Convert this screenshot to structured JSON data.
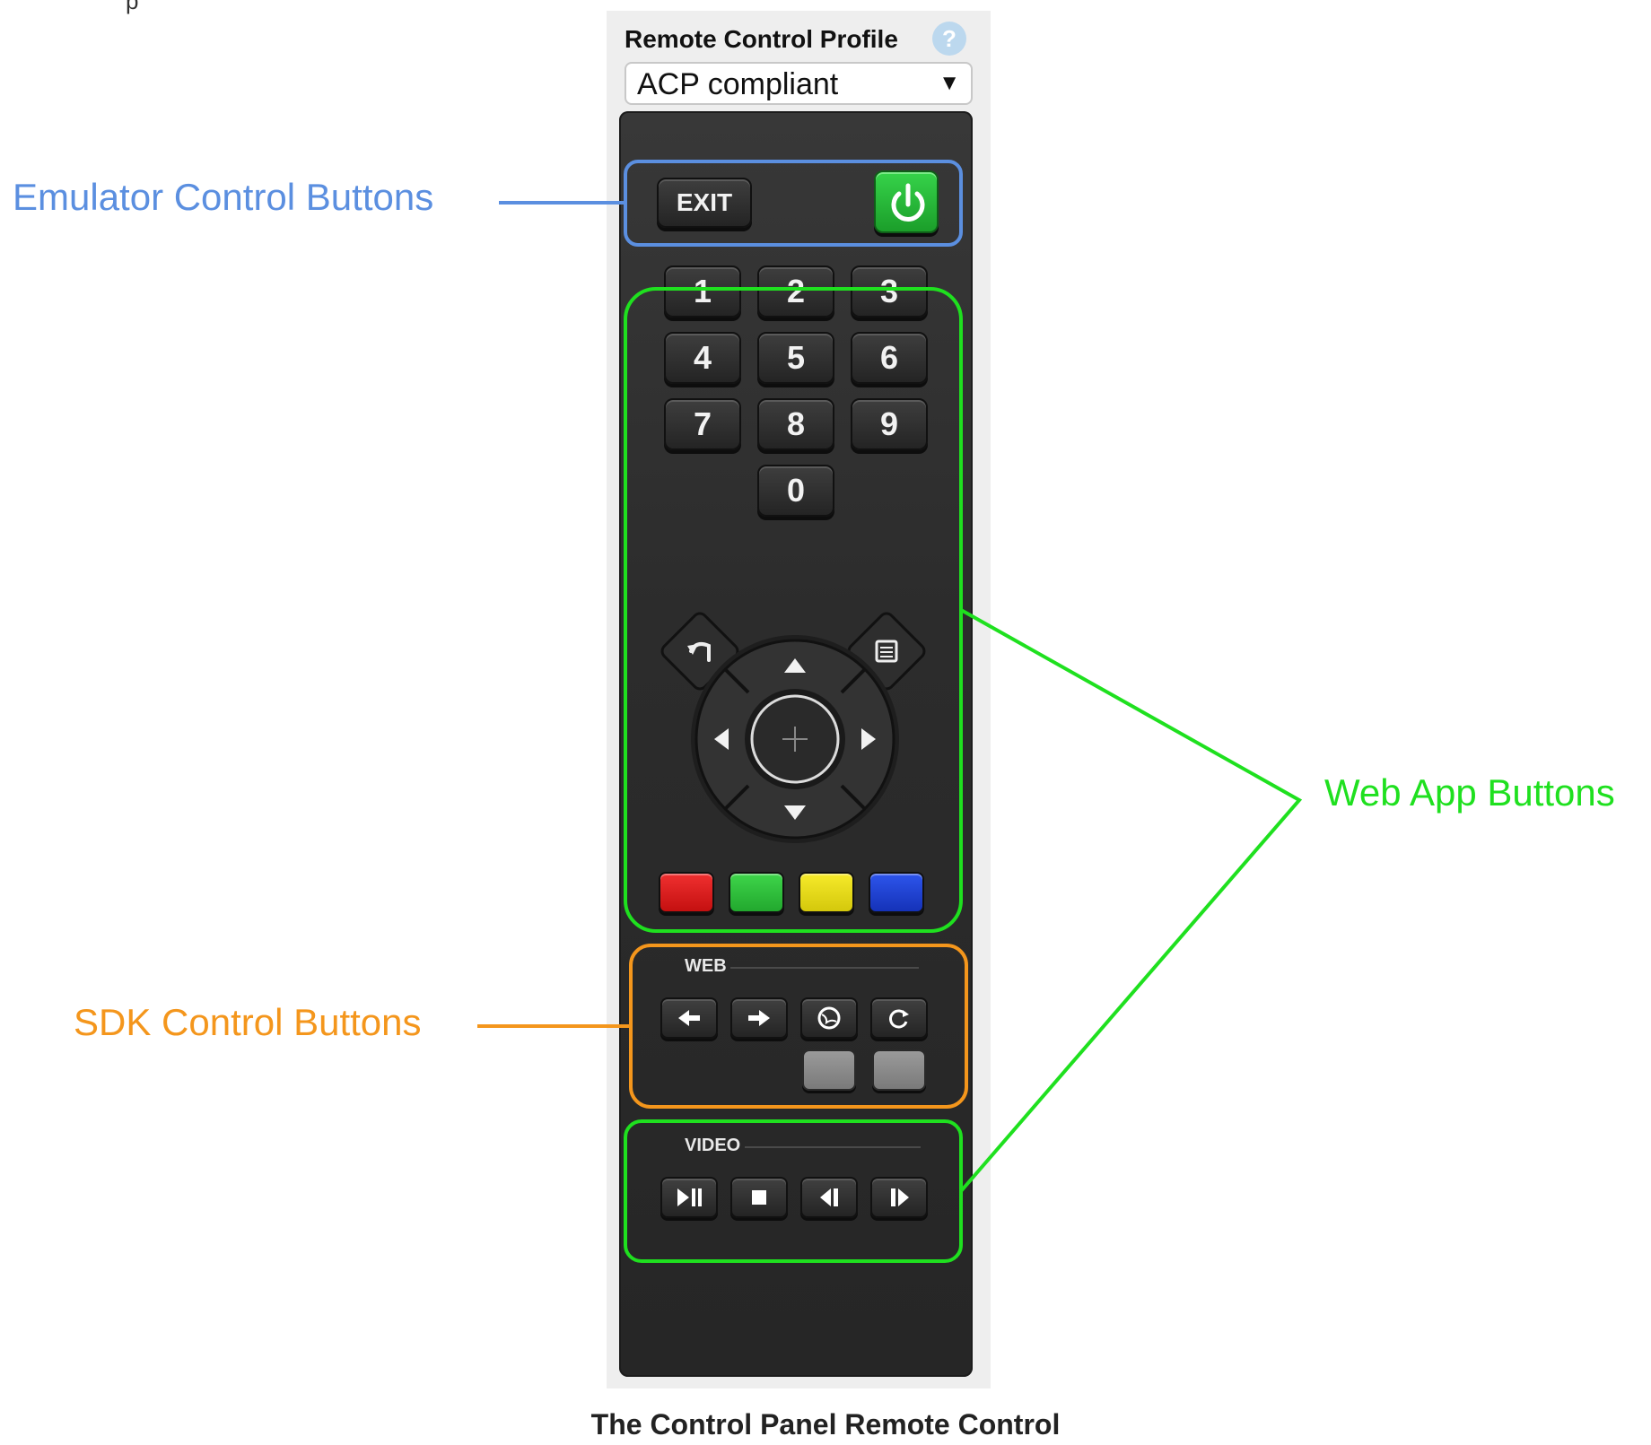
{
  "top_fragment": "p",
  "panel": {
    "profile_label": "Remote Control Profile",
    "help_icon_glyph": "?",
    "profile_select": {
      "value": "ACP compliant",
      "arrow": "▼"
    }
  },
  "remote": {
    "exit_label": "EXIT",
    "power_icon": "power-icon",
    "number_keys": [
      "1",
      "2",
      "3",
      "4",
      "5",
      "6",
      "7",
      "8",
      "9",
      "0"
    ],
    "nav_icons": [
      "back-icon",
      "menu-icon",
      "up-arrow-icon",
      "down-arrow-icon",
      "left-arrow-icon",
      "right-arrow-icon",
      "select-icon"
    ],
    "color_keys": [
      {
        "name": "red",
        "color": "#e21b1b"
      },
      {
        "name": "green",
        "color": "#2fc13a"
      },
      {
        "name": "yellow",
        "color": "#e8dc14"
      },
      {
        "name": "blue",
        "color": "#1a3fd6"
      }
    ],
    "web_section_label": "WEB",
    "web_icons": [
      "arrow-left-icon",
      "arrow-right-icon",
      "globe-icon",
      "reload-icon"
    ],
    "video_section_label": "VIDEO",
    "video_icons": [
      "play-pause-icon",
      "stop-icon",
      "step-back-icon",
      "step-forward-icon"
    ]
  },
  "annotations": {
    "emulator": {
      "label": "Emulator Control Buttons",
      "color": "#5b8fe0"
    },
    "web_app": {
      "label": "Web App Buttons",
      "color": "#1fe01f"
    },
    "sdk": {
      "label": "SDK Control Buttons",
      "color": "#f4961c"
    }
  },
  "caption": "The Control Panel Remote Control"
}
